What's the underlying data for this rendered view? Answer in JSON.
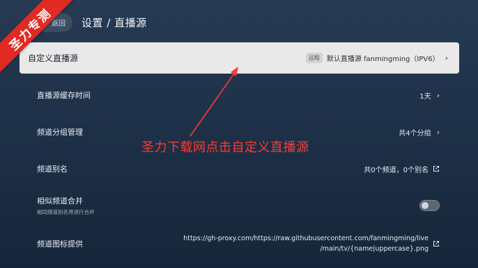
{
  "header": {
    "back_label": "返回",
    "title": "设置 / 直播源"
  },
  "ribbon": {
    "text": "圣力专测",
    "color": "#e02a22"
  },
  "rows": {
    "custom_source": {
      "label": "自定义直播源",
      "badge": "远程",
      "value": "默认直播源 fanmingming（IPV6）"
    },
    "cache_time": {
      "label": "直播源缓存时间",
      "value": "1天"
    },
    "group_manage": {
      "label": "频道分组管理",
      "value": "共4个分组"
    },
    "alias": {
      "label": "频道别名",
      "value": "共0个频道，0个别名"
    },
    "merge": {
      "label": "相似频道合并",
      "sub": "相同频道别名将进行合并",
      "toggle_on": false
    },
    "logo_provider": {
      "label": "频道图标提供",
      "value_line1": "https://gh-proxy.com/https://raw.githubusercontent.com/fanmingming/live",
      "value_line2": "/main/tv/{name|uppercase}.png"
    }
  },
  "annotation": {
    "text": "圣力下载网点击自定义直播源",
    "color": "#ff3a30"
  },
  "icons": {
    "chevron": "chevron-right-icon",
    "external": "external-link-icon"
  }
}
